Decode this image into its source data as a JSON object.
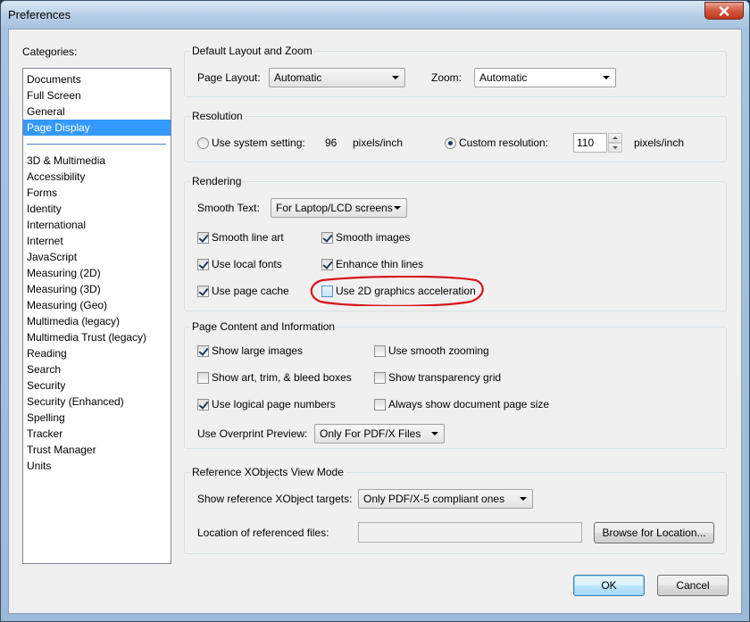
{
  "window": {
    "title": "Preferences"
  },
  "icons": {
    "close": "close-icon",
    "dropdown": "chevron-down-icon"
  },
  "colors": {
    "selection": "#3399ff",
    "annotation": "#d7141b"
  },
  "categories": {
    "label": "Categories:",
    "group1": [
      "Documents",
      "Full Screen",
      "General",
      "Page Display"
    ],
    "group2": [
      "3D & Multimedia",
      "Accessibility",
      "Forms",
      "Identity",
      "International",
      "Internet",
      "JavaScript",
      "Measuring (2D)",
      "Measuring (3D)",
      "Measuring (Geo)",
      "Multimedia (legacy)",
      "Multimedia Trust (legacy)",
      "Reading",
      "Search",
      "Security",
      "Security (Enhanced)",
      "Spelling",
      "Tracker",
      "Trust Manager",
      "Units"
    ],
    "selected": "Page Display"
  },
  "layout_zoom": {
    "title": "Default Layout and Zoom",
    "page_layout_label": "Page Layout:",
    "page_layout_value": "Automatic",
    "zoom_label": "Zoom:",
    "zoom_value": "Automatic"
  },
  "resolution": {
    "title": "Resolution",
    "system_label": "Use system setting:",
    "system_value": "96",
    "system_unit": "pixels/inch",
    "system_selected": false,
    "custom_label": "Custom resolution:",
    "custom_value": "110",
    "custom_unit": "pixels/inch",
    "custom_selected": true
  },
  "rendering": {
    "title": "Rendering",
    "smooth_text_label": "Smooth Text:",
    "smooth_text_value": "For Laptop/LCD screens",
    "options": [
      {
        "label": "Smooth line art",
        "checked": true
      },
      {
        "label": "Smooth images",
        "checked": true
      },
      {
        "label": "Use local fonts",
        "checked": true
      },
      {
        "label": "Enhance thin lines",
        "checked": true
      },
      {
        "label": "Use page cache",
        "checked": true
      },
      {
        "label": "Use 2D graphics acceleration",
        "checked": false
      }
    ]
  },
  "page_content": {
    "title": "Page Content and Information",
    "options": [
      {
        "label": "Show large images",
        "checked": true
      },
      {
        "label": "Use smooth zooming",
        "checked": false
      },
      {
        "label": "Show art, trim, & bleed boxes",
        "checked": false
      },
      {
        "label": "Show transparency grid",
        "checked": false
      },
      {
        "label": "Use logical page numbers",
        "checked": true
      },
      {
        "label": "Always show document page size",
        "checked": false
      }
    ],
    "overprint_label": "Use Overprint Preview:",
    "overprint_value": "Only For PDF/X Files"
  },
  "xobjects": {
    "title": "Reference XObjects View Mode",
    "targets_label": "Show reference XObject targets:",
    "targets_value": "Only PDF/X-5 compliant ones",
    "location_label": "Location of referenced files:",
    "location_value": "",
    "browse_label": "Browse for Location..."
  },
  "footer": {
    "ok_label": "OK",
    "cancel_label": "Cancel"
  }
}
